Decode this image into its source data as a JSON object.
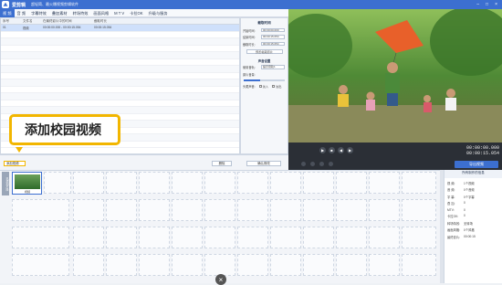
{
  "title": {
    "app_name": "爱剪辑",
    "subtitle": "超轻简、最火爆视频剪辑软件"
  },
  "menu": [
    "视 频",
    "音 频",
    "字幕特效",
    "叠加素材",
    "转场特效",
    "画面风格",
    "M T V",
    "卡拉OK",
    "升级与服务"
  ],
  "clip_table": {
    "headers": [
      "序号",
      "文件名",
      "在最终影片中的时间",
      "截取时长"
    ],
    "rows": [
      [
        "01",
        "视频",
        "00:00:00.000 - 00:00:15.054",
        "00:00:15.054"
      ]
    ]
  },
  "clip_props": {
    "header": "截取时间",
    "start_label": "开始时间:",
    "start_value": "00:00:00.000",
    "end_label": "结束时间:",
    "end_value": "00:00:15.054",
    "duration_label": "截取时长:",
    "duration_value": "00:00:15.054",
    "preview_btn": "预览/截取原片",
    "audio_header": "声音设置",
    "mode_label": "使用音轨:",
    "mode_value": "提示音轨1",
    "volume_label": "原片音量:",
    "fade_label": "头尾声音:",
    "fade_in": "淡入",
    "fade_out": "淡出"
  },
  "buttons": {
    "add_video": "添加视频",
    "delete": "删除",
    "confirm": "确认修改",
    "export": "导出视频"
  },
  "player": {
    "current_time": "00:00:00.000",
    "total_time": "00:00:15.054"
  },
  "tooltip": "添加校园视频",
  "timeline": {
    "side_tab": "已添加片段",
    "first_clip_caption": "视频"
  },
  "info_panel": {
    "title": "所有制作的信息",
    "items": [
      {
        "label": "视 频:",
        "value": "1个视频"
      },
      {
        "label": "音 频:",
        "value": "0个音频"
      },
      {
        "label": "字 幕:",
        "value": "0个字幕"
      },
      {
        "label": "叠 加:",
        "value": "0"
      },
      {
        "label": "MTV:",
        "value": "0"
      },
      {
        "label": "卡拉OK:",
        "value": "0"
      },
      {
        "label": "转场特效:",
        "value": "无转场"
      },
      {
        "label": "画面风格:",
        "value": "0个风格"
      },
      {
        "label": "最终影片:",
        "value": "00:00:15"
      }
    ]
  },
  "colors": {
    "accent": "#3c6fd0",
    "highlight": "#f2b600"
  }
}
